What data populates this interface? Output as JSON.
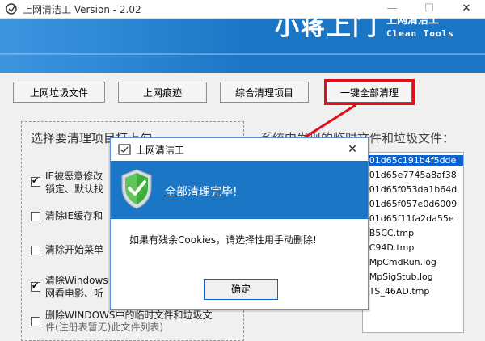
{
  "window": {
    "title": "上网清洁工 Version - 2.02",
    "minimize": "—",
    "maximize": "☐",
    "close": "✕"
  },
  "banner": {
    "brand_big": "小蒋上门",
    "brand_cn": "上网清洁工",
    "brand_en": "Clean Tools",
    "color": "#1b77c6"
  },
  "tabs": [
    {
      "label": "上网垃圾文件"
    },
    {
      "label": "上网痕迹"
    },
    {
      "label": "综合清理项目"
    },
    {
      "label": "一键全部清理"
    }
  ],
  "left_panel": {
    "title": "选择要清理项目打上勾",
    "options": [
      {
        "text": "IE被恶意修改",
        "text2": "锁定、默认找",
        "checked": true
      },
      {
        "text": "清除IE缓存和",
        "checked": false
      },
      {
        "text": "清除开始菜单",
        "checked": false
      },
      {
        "text": "清除Windows",
        "text2": "网看电影、听",
        "checked": true
      },
      {
        "text": "删除WINDOWS中的临时文件和垃圾文",
        "text2": "件(注册表暂无)此文件列表)",
        "checked": false
      }
    ]
  },
  "right_panel": {
    "title": "系统中发现的临时文件和垃圾文件：",
    "files": [
      "\\01d65c191b4f5dde",
      "\\01d65e7745a8af38",
      "\\01d65f053da1b64d",
      "\\01d65f057e0d6009",
      "\\01d65f11fa2da55e",
      "\\B5CC.tmp",
      "\\C94D.tmp",
      "\\MpCmdRun.log",
      "\\MpSigStub.log",
      "\\TS_46AD.tmp"
    ]
  },
  "dialog": {
    "title": "上网清洁工",
    "close": "✕",
    "header_message": "全部清理完毕!",
    "body_text": "如果有残余Cookies，请选择性用手动删除!",
    "ok_label": "确定"
  }
}
